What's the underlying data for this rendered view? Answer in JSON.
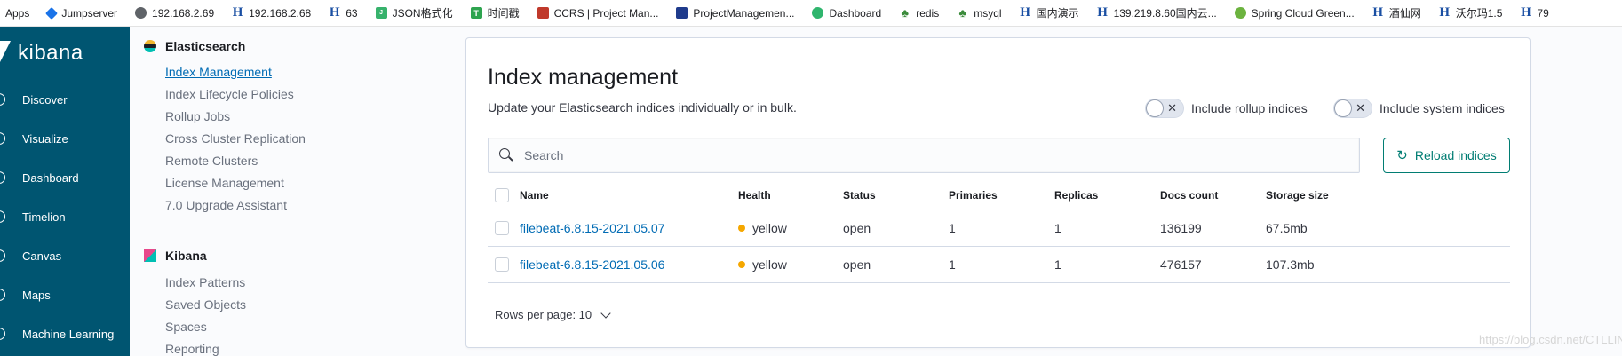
{
  "bookmarks": [
    {
      "label": "Apps",
      "icon": "apps-icon"
    },
    {
      "label": "Jumpserver",
      "icon": "jumpserver-icon"
    },
    {
      "label": "192.168.2.69",
      "icon": "globe-icon"
    },
    {
      "label": "192.168.2.68",
      "icon": "h-icon"
    },
    {
      "label": "63",
      "icon": "h-icon"
    },
    {
      "label": "JSON格式化",
      "icon": "json-icon"
    },
    {
      "label": "时间戳",
      "icon": "timestamp-icon"
    },
    {
      "label": "CCRS | Project Man...",
      "icon": "ccrs-icon"
    },
    {
      "label": "ProjectManagemen...",
      "icon": "pm-icon"
    },
    {
      "label": "Dashboard",
      "icon": "dashboard-icon"
    },
    {
      "label": "redis",
      "icon": "tree-icon"
    },
    {
      "label": "msyql",
      "icon": "tree-icon"
    },
    {
      "label": "国内演示",
      "icon": "h-icon"
    },
    {
      "label": "139.219.8.60国内云...",
      "icon": "h-icon"
    },
    {
      "label": "Spring Cloud Green...",
      "icon": "cloud-icon"
    },
    {
      "label": "酒仙网",
      "icon": "h-icon"
    },
    {
      "label": "沃尔玛1.5",
      "icon": "h-icon"
    },
    {
      "label": "79",
      "icon": "h-icon"
    }
  ],
  "kibana_nav": {
    "logo": "kibana",
    "items": [
      "Discover",
      "Visualize",
      "Dashboard",
      "Timelion",
      "Canvas",
      "Maps",
      "Machine Learning"
    ]
  },
  "sidebar": {
    "elasticsearch": {
      "title": "Elasticsearch",
      "links": [
        "Index Management",
        "Index Lifecycle Policies",
        "Rollup Jobs",
        "Cross Cluster Replication",
        "Remote Clusters",
        "License Management",
        "7.0 Upgrade Assistant"
      ]
    },
    "kibana": {
      "title": "Kibana",
      "links": [
        "Index Patterns",
        "Saved Objects",
        "Spaces",
        "Reporting"
      ]
    }
  },
  "main": {
    "title": "Index management",
    "subtitle": "Update your Elasticsearch indices individually or in bulk.",
    "toggle_rollup": "Include rollup indices",
    "toggle_system": "Include system indices",
    "search_placeholder": "Search",
    "reload_label": "Reload indices",
    "columns": [
      "Name",
      "Health",
      "Status",
      "Primaries",
      "Replicas",
      "Docs count",
      "Storage size"
    ],
    "rows": [
      {
        "name": "filebeat-6.8.15-2021.05.07",
        "health": "yellow",
        "status": "open",
        "primaries": "1",
        "replicas": "1",
        "docs": "136199",
        "size": "67.5mb"
      },
      {
        "name": "filebeat-6.8.15-2021.05.06",
        "health": "yellow",
        "status": "open",
        "primaries": "1",
        "replicas": "1",
        "docs": "476157",
        "size": "107.3mb"
      }
    ],
    "rows_per_page": "Rows per page: 10"
  },
  "watermark": "https://blog.csdn.net/CTLLIN",
  "colors": {
    "kibana_nav_bg": "#005571",
    "link": "#006bb4",
    "reload": "#017d73",
    "health_yellow": "#f5a700"
  }
}
